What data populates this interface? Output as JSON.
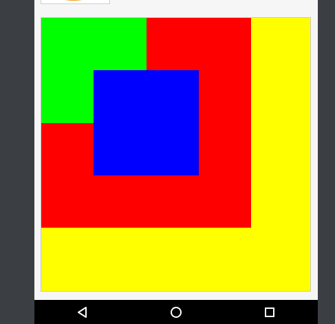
{
  "colors": {
    "outer_square": "#ffff00",
    "middle_square": "#ff0000",
    "top_left_square": "#00ff00",
    "center_square": "#0000ff",
    "nav_bar": "#000000",
    "nav_icon": "#ffffff"
  },
  "thumbnail": {
    "icon": "orange-fruit-image"
  },
  "navigation": {
    "back_icon": "back-triangle-icon",
    "home_icon": "home-circle-icon",
    "recents_icon": "recents-square-icon"
  }
}
